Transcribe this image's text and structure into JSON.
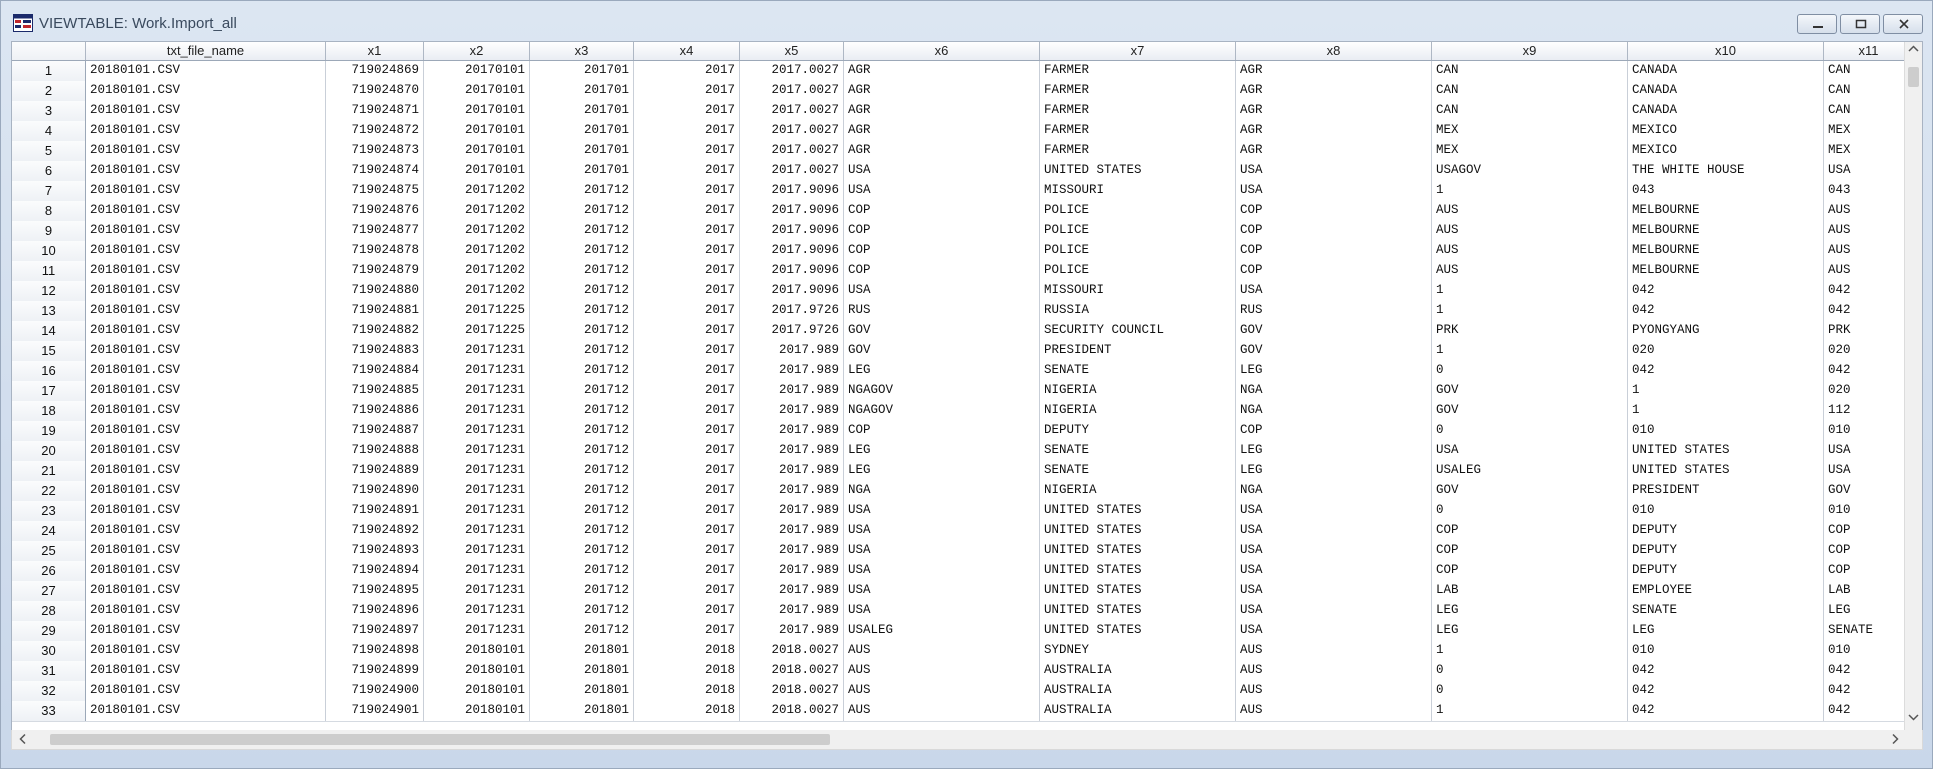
{
  "window": {
    "title": "VIEWTABLE: Work.Import_all"
  },
  "table": {
    "columns": [
      "txt_file_name",
      "x1",
      "x2",
      "x3",
      "x4",
      "x5",
      "x6",
      "x7",
      "x8",
      "x9",
      "x10",
      "x11"
    ],
    "rows": [
      [
        "1",
        "20180101.CSV",
        "719024869",
        "20170101",
        "201701",
        "2017",
        "2017.0027",
        "AGR",
        "FARMER",
        "AGR",
        "CAN",
        "CANADA",
        "CAN"
      ],
      [
        "2",
        "20180101.CSV",
        "719024870",
        "20170101",
        "201701",
        "2017",
        "2017.0027",
        "AGR",
        "FARMER",
        "AGR",
        "CAN",
        "CANADA",
        "CAN"
      ],
      [
        "3",
        "20180101.CSV",
        "719024871",
        "20170101",
        "201701",
        "2017",
        "2017.0027",
        "AGR",
        "FARMER",
        "AGR",
        "CAN",
        "CANADA",
        "CAN"
      ],
      [
        "4",
        "20180101.CSV",
        "719024872",
        "20170101",
        "201701",
        "2017",
        "2017.0027",
        "AGR",
        "FARMER",
        "AGR",
        "MEX",
        "MEXICO",
        "MEX"
      ],
      [
        "5",
        "20180101.CSV",
        "719024873",
        "20170101",
        "201701",
        "2017",
        "2017.0027",
        "AGR",
        "FARMER",
        "AGR",
        "MEX",
        "MEXICO",
        "MEX"
      ],
      [
        "6",
        "20180101.CSV",
        "719024874",
        "20170101",
        "201701",
        "2017",
        "2017.0027",
        "USA",
        "UNITED STATES",
        "USA",
        "USAGOV",
        "THE WHITE HOUSE",
        "USA"
      ],
      [
        "7",
        "20180101.CSV",
        "719024875",
        "20171202",
        "201712",
        "2017",
        "2017.9096",
        "USA",
        "MISSOURI",
        "USA",
        "1",
        "043",
        "043"
      ],
      [
        "8",
        "20180101.CSV",
        "719024876",
        "20171202",
        "201712",
        "2017",
        "2017.9096",
        "COP",
        "POLICE",
        "COP",
        "AUS",
        "MELBOURNE",
        "AUS"
      ],
      [
        "9",
        "20180101.CSV",
        "719024877",
        "20171202",
        "201712",
        "2017",
        "2017.9096",
        "COP",
        "POLICE",
        "COP",
        "AUS",
        "MELBOURNE",
        "AUS"
      ],
      [
        "10",
        "20180101.CSV",
        "719024878",
        "20171202",
        "201712",
        "2017",
        "2017.9096",
        "COP",
        "POLICE",
        "COP",
        "AUS",
        "MELBOURNE",
        "AUS"
      ],
      [
        "11",
        "20180101.CSV",
        "719024879",
        "20171202",
        "201712",
        "2017",
        "2017.9096",
        "COP",
        "POLICE",
        "COP",
        "AUS",
        "MELBOURNE",
        "AUS"
      ],
      [
        "12",
        "20180101.CSV",
        "719024880",
        "20171202",
        "201712",
        "2017",
        "2017.9096",
        "USA",
        "MISSOURI",
        "USA",
        "1",
        "042",
        "042"
      ],
      [
        "13",
        "20180101.CSV",
        "719024881",
        "20171225",
        "201712",
        "2017",
        "2017.9726",
        "RUS",
        "RUSSIA",
        "RUS",
        "1",
        "042",
        "042"
      ],
      [
        "14",
        "20180101.CSV",
        "719024882",
        "20171225",
        "201712",
        "2017",
        "2017.9726",
        "GOV",
        "SECURITY COUNCIL",
        "GOV",
        "PRK",
        "PYONGYANG",
        "PRK"
      ],
      [
        "15",
        "20180101.CSV",
        "719024883",
        "20171231",
        "201712",
        "2017",
        "2017.989",
        "GOV",
        "PRESIDENT",
        "GOV",
        "1",
        "020",
        "020"
      ],
      [
        "16",
        "20180101.CSV",
        "719024884",
        "20171231",
        "201712",
        "2017",
        "2017.989",
        "LEG",
        "SENATE",
        "LEG",
        "0",
        "042",
        "042"
      ],
      [
        "17",
        "20180101.CSV",
        "719024885",
        "20171231",
        "201712",
        "2017",
        "2017.989",
        "NGAGOV",
        "NIGERIA",
        "NGA",
        "GOV",
        "1",
        "020"
      ],
      [
        "18",
        "20180101.CSV",
        "719024886",
        "20171231",
        "201712",
        "2017",
        "2017.989",
        "NGAGOV",
        "NIGERIA",
        "NGA",
        "GOV",
        "1",
        "112"
      ],
      [
        "19",
        "20180101.CSV",
        "719024887",
        "20171231",
        "201712",
        "2017",
        "2017.989",
        "COP",
        "DEPUTY",
        "COP",
        "0",
        "010",
        "010"
      ],
      [
        "20",
        "20180101.CSV",
        "719024888",
        "20171231",
        "201712",
        "2017",
        "2017.989",
        "LEG",
        "SENATE",
        "LEG",
        "USA",
        "UNITED STATES",
        "USA"
      ],
      [
        "21",
        "20180101.CSV",
        "719024889",
        "20171231",
        "201712",
        "2017",
        "2017.989",
        "LEG",
        "SENATE",
        "LEG",
        "USALEG",
        "UNITED STATES",
        "USA"
      ],
      [
        "22",
        "20180101.CSV",
        "719024890",
        "20171231",
        "201712",
        "2017",
        "2017.989",
        "NGA",
        "NIGERIA",
        "NGA",
        "GOV",
        "PRESIDENT",
        "GOV"
      ],
      [
        "23",
        "20180101.CSV",
        "719024891",
        "20171231",
        "201712",
        "2017",
        "2017.989",
        "USA",
        "UNITED STATES",
        "USA",
        "0",
        "010",
        "010"
      ],
      [
        "24",
        "20180101.CSV",
        "719024892",
        "20171231",
        "201712",
        "2017",
        "2017.989",
        "USA",
        "UNITED STATES",
        "USA",
        "COP",
        "DEPUTY",
        "COP"
      ],
      [
        "25",
        "20180101.CSV",
        "719024893",
        "20171231",
        "201712",
        "2017",
        "2017.989",
        "USA",
        "UNITED STATES",
        "USA",
        "COP",
        "DEPUTY",
        "COP"
      ],
      [
        "26",
        "20180101.CSV",
        "719024894",
        "20171231",
        "201712",
        "2017",
        "2017.989",
        "USA",
        "UNITED STATES",
        "USA",
        "COP",
        "DEPUTY",
        "COP"
      ],
      [
        "27",
        "20180101.CSV",
        "719024895",
        "20171231",
        "201712",
        "2017",
        "2017.989",
        "USA",
        "UNITED STATES",
        "USA",
        "LAB",
        "EMPLOYEE",
        "LAB"
      ],
      [
        "28",
        "20180101.CSV",
        "719024896",
        "20171231",
        "201712",
        "2017",
        "2017.989",
        "USA",
        "UNITED STATES",
        "USA",
        "LEG",
        "SENATE",
        "LEG"
      ],
      [
        "29",
        "20180101.CSV",
        "719024897",
        "20171231",
        "201712",
        "2017",
        "2017.989",
        "USALEG",
        "UNITED STATES",
        "USA",
        "LEG",
        "LEG",
        "SENATE"
      ],
      [
        "30",
        "20180101.CSV",
        "719024898",
        "20180101",
        "201801",
        "2018",
        "2018.0027",
        "AUS",
        "SYDNEY",
        "AUS",
        "1",
        "010",
        "010"
      ],
      [
        "31",
        "20180101.CSV",
        "719024899",
        "20180101",
        "201801",
        "2018",
        "2018.0027",
        "AUS",
        "AUSTRALIA",
        "AUS",
        "0",
        "042",
        "042"
      ],
      [
        "32",
        "20180101.CSV",
        "719024900",
        "20180101",
        "201801",
        "2018",
        "2018.0027",
        "AUS",
        "AUSTRALIA",
        "AUS",
        "0",
        "042",
        "042"
      ],
      [
        "33",
        "20180101.CSV",
        "719024901",
        "20180101",
        "201801",
        "2018",
        "2018.0027",
        "AUS",
        "AUSTRALIA",
        "AUS",
        "1",
        "042",
        "042"
      ]
    ]
  }
}
